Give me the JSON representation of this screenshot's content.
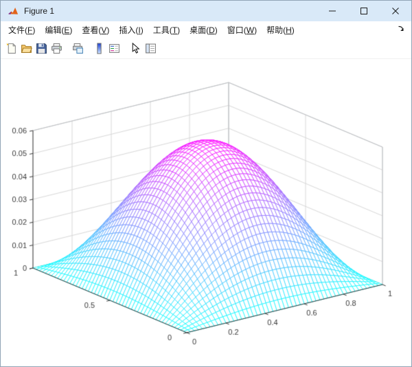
{
  "ui_colors": {
    "titlebar_bg": "#d9e9f8",
    "menu_text": "#1a1a1a",
    "window_border": "#90a4b5"
  },
  "window": {
    "title": "Figure 1",
    "icons": [
      "matlab-logo-icon",
      "minimize-icon",
      "maximize-icon",
      "close-icon"
    ]
  },
  "menubar": {
    "items": [
      {
        "name": "file",
        "text": "文件",
        "mnemonic": "F"
      },
      {
        "name": "edit",
        "text": "编辑",
        "mnemonic": "E"
      },
      {
        "name": "view",
        "text": "查看",
        "mnemonic": "V"
      },
      {
        "name": "insert",
        "text": "插入",
        "mnemonic": "I"
      },
      {
        "name": "tools",
        "text": "工具",
        "mnemonic": "T"
      },
      {
        "name": "desktop",
        "text": "桌面",
        "mnemonic": "D"
      },
      {
        "name": "window",
        "text": "窗口",
        "mnemonic": "W"
      },
      {
        "name": "help",
        "text": "帮助",
        "mnemonic": "H"
      }
    ],
    "dock_icon": "dock-figure-icon"
  },
  "toolbar": {
    "buttons": [
      {
        "name": "new-figure-button",
        "icon": "new-document-icon",
        "gap": false
      },
      {
        "name": "open-file-button",
        "icon": "open-folder-icon",
        "gap": false
      },
      {
        "name": "save-figure-button",
        "icon": "save-floppy-icon",
        "gap": false
      },
      {
        "name": "print-figure-button",
        "icon": "printer-icon",
        "gap": false
      },
      {
        "name": "print-preview-button",
        "icon": "print-preview-icon",
        "gap": true
      },
      {
        "name": "insert-colorbar-button",
        "icon": "colorbar-icon",
        "gap": true
      },
      {
        "name": "insert-legend-button",
        "icon": "legend-icon",
        "gap": false
      },
      {
        "name": "edit-plot-button",
        "icon": "cursor-arrow-icon",
        "gap": true
      },
      {
        "name": "property-inspector-button",
        "icon": "property-inspector-icon",
        "gap": false
      }
    ]
  },
  "chart_data": {
    "type": "surface",
    "surface_kind": "mesh",
    "title": "",
    "xlabel": "",
    "ylabel": "",
    "zlabel": "",
    "x_range": [
      0,
      1
    ],
    "y_range": [
      0,
      1
    ],
    "z_range": [
      0,
      0.06
    ],
    "x_ticks": [
      0,
      0.2,
      0.4,
      0.6,
      0.8,
      1
    ],
    "x_tick_labels": [
      "0",
      "0.2",
      "0.4",
      "0.6",
      "0.8",
      "1"
    ],
    "y_ticks": [
      0,
      0.5,
      1
    ],
    "y_tick_labels": [
      "0",
      "0.5",
      "1"
    ],
    "z_ticks": [
      0,
      0.01,
      0.02,
      0.03,
      0.04,
      0.05,
      0.06
    ],
    "z_tick_labels": [
      "0",
      "0.01",
      "0.02",
      "0.03",
      "0.04",
      "0.05",
      "0.06"
    ],
    "grid": true,
    "mesh_n": 50,
    "peak_z": 0.0585,
    "surface_formula": "z = 0.0585 * sin(pi*x) * sin(pi*y)",
    "colormap": "cool",
    "colormap_low": "#00FFFF",
    "colormap_high": "#FF00FF",
    "grid_color": "#d8d8d8",
    "box_edge_color": "#bcbfc3",
    "axis_color": "#3a3a3a",
    "background": "#ffffff",
    "view": {
      "azimuth": -37.5,
      "elevation": 30
    }
  }
}
